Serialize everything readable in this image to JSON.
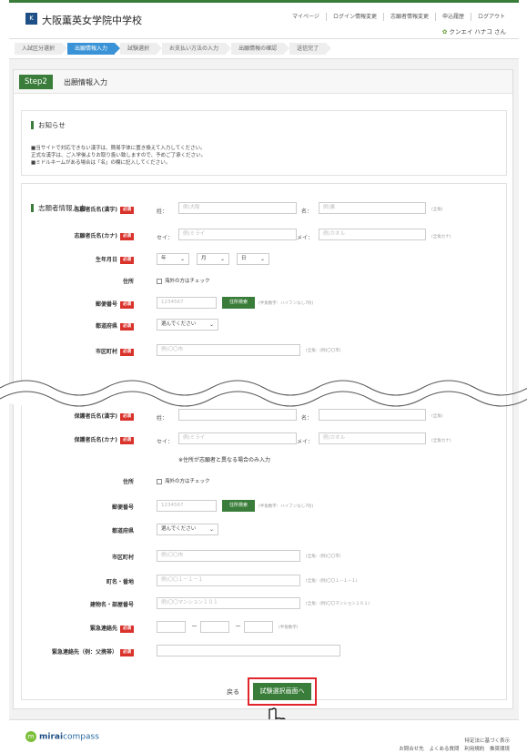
{
  "header": {
    "logo_mark": "K",
    "school_name": "大阪薫英女学院中学校",
    "nav": [
      "マイページ",
      "ログイン情報変更",
      "志願者情報変更",
      "申込履歴",
      "ログアウト"
    ],
    "user_name": "クンエイ ハナコ さん"
  },
  "steps": [
    "入試区分選択",
    "出願情報入力",
    "試験選択",
    "お支払い方法の入力",
    "出願情報の確認",
    "送信完了"
  ],
  "step_badge": "Step2",
  "step_title": "出願情報入力",
  "notice": {
    "title": "お知らせ",
    "lines": [
      "■当サイトで対応できない漢字は、簡易字体に置き換えて入力してください。",
      "正式な漢字は、ご入学後よりお取り扱い致しますので、予めご了承ください。",
      "■ミドルネームがある場合は「名」の欄に記入してください。"
    ]
  },
  "applicant": {
    "title": "志願者情報入力",
    "req": "必須",
    "name_kanji_label": "志願者氏名(漢字)",
    "sei_label": "姓：",
    "sei_ph": "例)大阪",
    "mei_label": "名：",
    "mei_ph": "例)薫",
    "name_kanji_hint": "(全角)",
    "name_kana_label": "志願者氏名(カナ)",
    "sei_kana_label": "セイ：",
    "sei_kana_ph": "例)ミライ",
    "mei_kana_label": "メイ：",
    "mei_kana_ph": "例)カオル",
    "name_kana_hint": "(全角カナ)",
    "birth_label": "生年月日",
    "year": "年",
    "month": "月",
    "day": "日",
    "address_label": "住所",
    "overseas": "海外の方はチェック",
    "zip_label": "郵便番号",
    "zip_ph": "1234567",
    "zip_btn": "住所検索",
    "zip_hint": "(半角数字：ハイフンなし7桁)",
    "pref_label": "都道府県",
    "pref_select": "選んでください",
    "city_label": "市区町村",
    "city_ph": "例)〇〇市",
    "city_hint": "(全角：(例)〇〇市)"
  },
  "guardian": {
    "name_kanji_label": "保護者氏名(漢字)",
    "sei_label": "姓：",
    "mei_label": "名：",
    "hint": "(全角)",
    "name_kana_label": "保護者氏名(カナ)",
    "sei_kana_label": "セイ：",
    "sei_kana_ph": "例)ミライ",
    "mei_kana_label": "メイ：",
    "mei_kana_ph": "例)カオル",
    "name_kana_hint": "(全角カナ)",
    "addr_note": "※住所が志願者と異なる場合のみ入力",
    "address_label": "住所",
    "overseas": "海外の方はチェック",
    "zip_label": "郵便番号",
    "zip_ph": "1234567",
    "zip_btn": "住所検索",
    "zip_hint": "(半角数字：ハイフンなし7桁)",
    "pref_label": "都道府県",
    "pref_select": "選んでください",
    "city_label": "市区町村",
    "city_ph": "例)〇〇市",
    "city_hint": "(全角：(例)〇〇市)",
    "town_label": "町名・番地",
    "town_ph": "例)〇〇１－１－１",
    "town_hint": "(全角：(例)〇〇１－１－１)",
    "bldg_label": "建物名・部屋番号",
    "bldg_ph": "例)〇〇マンション１０１",
    "bldg_hint": "(全角：(例)〇〇マンション１０１)",
    "emergency_label": "緊急連絡先",
    "dash": "－",
    "emergency_hint": "(半角数字)",
    "emergency2_label": "緊急連絡先（例：父携帯）",
    "req": "必須"
  },
  "actions": {
    "back": "戻る",
    "next": "試験選択画面へ"
  },
  "footer": {
    "brand_mark": "m",
    "brand_bold": "mirai",
    "brand_rest": "compass",
    "tokusho": "特定法に基づく表示",
    "links": [
      "お問合せ先",
      "よくある質問",
      "利用規約",
      "推奨環境"
    ]
  },
  "colors": {
    "accent_green": "#3a7d3a",
    "step_active": "#3a93d6",
    "required_red": "#d9322b",
    "highlight_red": "#e0262b"
  }
}
